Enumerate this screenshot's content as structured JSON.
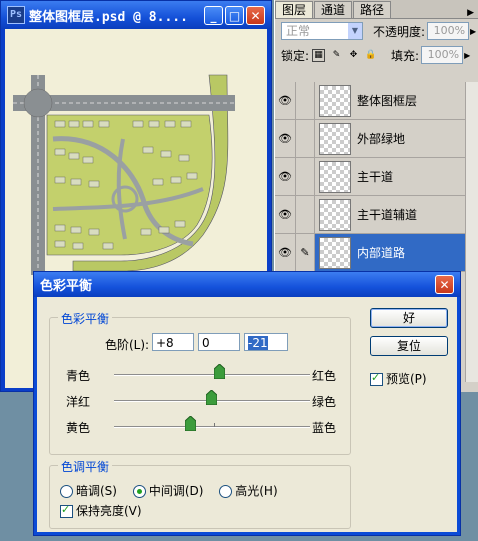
{
  "document": {
    "title": "整体图框层.psd @ 8....",
    "app_icon": "Ps"
  },
  "panel": {
    "tabs": [
      "图层",
      "通道",
      "路径"
    ],
    "blend_mode": "正常",
    "opacity_label": "不透明度:",
    "opacity_value": "100%",
    "lock_label": "锁定:",
    "fill_label": "填充:",
    "fill_value": "100%",
    "layers": [
      {
        "name": "整体图框层",
        "visible": true,
        "selected": false
      },
      {
        "name": "外部绿地",
        "visible": true,
        "selected": false
      },
      {
        "name": "主干道",
        "visible": true,
        "selected": false
      },
      {
        "name": "主干道辅道",
        "visible": true,
        "selected": false
      },
      {
        "name": "内部道路",
        "visible": true,
        "selected": true
      }
    ]
  },
  "dialog": {
    "title": "色彩平衡",
    "group1_title": "色彩平衡",
    "levels_label": "色阶(L):",
    "levels": [
      "+8",
      "0",
      "-21"
    ],
    "sliders": [
      {
        "left": "青色",
        "right": "红色",
        "value": 8
      },
      {
        "left": "洋红",
        "right": "绿色",
        "value": 0
      },
      {
        "left": "黄色",
        "right": "蓝色",
        "value": -21
      }
    ],
    "group2_title": "色调平衡",
    "tones": [
      "暗调(S)",
      "中间调(D)",
      "高光(H)"
    ],
    "selected_tone": "中间调(D)",
    "preserve_label": "保持亮度(V)",
    "preserve_checked": true,
    "ok_label": "好",
    "reset_label": "复位",
    "preview_label": "预览(P)",
    "preview_checked": true
  },
  "colors": {
    "accent": "#316ac5",
    "title_blue": "#1450d8",
    "map_green": "#b9c864",
    "road_gray": "#8a8f92"
  }
}
